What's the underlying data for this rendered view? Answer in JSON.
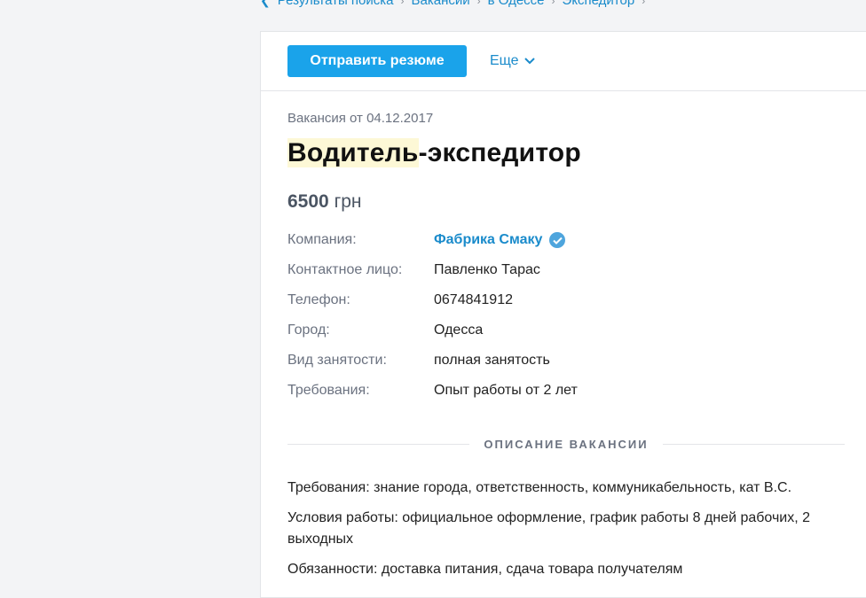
{
  "breadcrumb": {
    "items": [
      "Результаты поиска",
      "Вакансии",
      "в Одессе",
      "Экспедитор"
    ]
  },
  "toolbar": {
    "send_resume_label": "Отправить резюме",
    "more_label": "Еще"
  },
  "vacancy": {
    "date_label": "Вакансия от 04.12.2017",
    "title_highlight": "Водитель",
    "title_rest": "-экспедитор",
    "salary_amount": "6500",
    "salary_currency": "грн"
  },
  "details": {
    "company_label": "Компания:",
    "company_value": "Фабрика Смаку",
    "contact_label": "Контактное лицо:",
    "contact_value": "Павленко Тарас",
    "phone_label": "Телефон:",
    "phone_value": "0674841912",
    "city_label": "Город:",
    "city_value": "Одесса",
    "employment_label": "Вид занятости:",
    "employment_value": "полная занятость",
    "requirements_label": "Требования:",
    "requirements_value": "Опыт работы от 2 лет"
  },
  "description": {
    "heading": "ОПИСАНИЕ ВАКАНСИИ",
    "p1": "Требования: знание города, ответственность, коммуникабельность, кат В.С.",
    "p2": "Условия работы: официальное оформление, график работы 8 дней рабочих, 2 выходных",
    "p3": "Обязанности: доставка питания, сдача товара получателям"
  },
  "colors": {
    "accent": "#1aa3ea",
    "link": "#1a8bcb",
    "highlight": "#fdf8d6"
  }
}
